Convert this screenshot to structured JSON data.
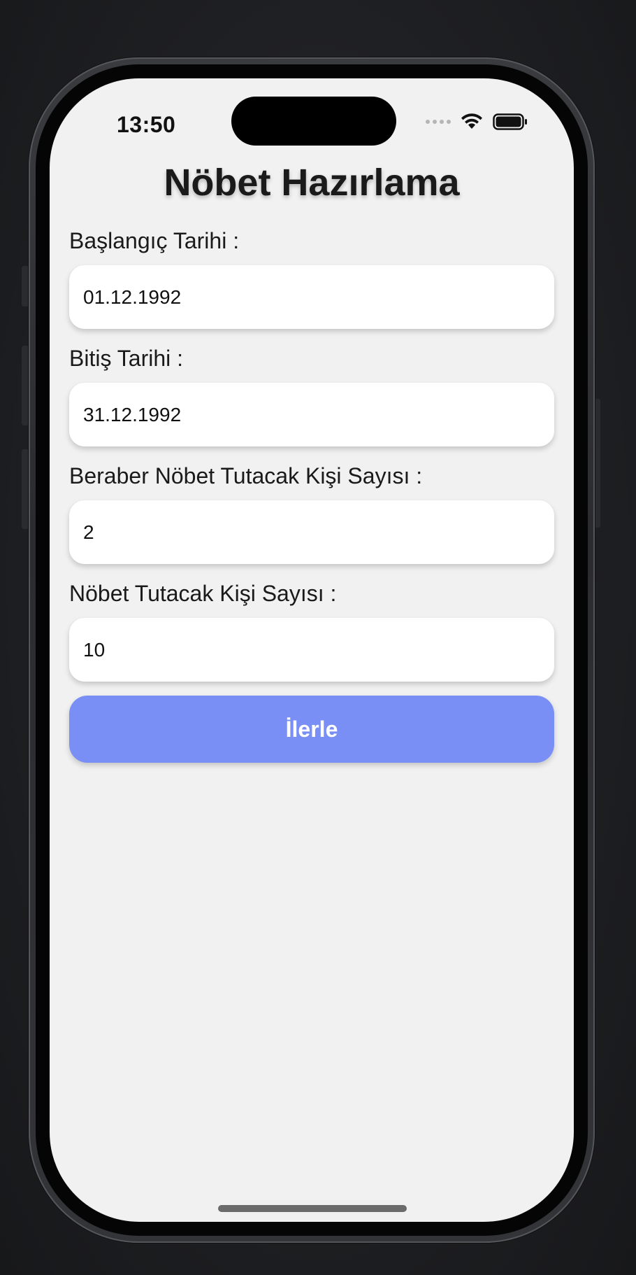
{
  "status_bar": {
    "time": "13:50"
  },
  "page": {
    "title": "Nöbet Hazırlama"
  },
  "form": {
    "fields": [
      {
        "label": "Başlangıç Tarihi :",
        "value": "01.12.1992"
      },
      {
        "label": "Bitiş Tarihi :",
        "value": "31.12.1992"
      },
      {
        "label": "Beraber Nöbet Tutacak Kişi Sayısı :",
        "value": "2"
      },
      {
        "label": "Nöbet Tutacak Kişi Sayısı :",
        "value": "10"
      }
    ],
    "submit_label": "İlerle"
  },
  "icons": [
    "signal-icon",
    "wifi-icon",
    "battery-icon"
  ],
  "colors": {
    "screen_background": "#f1f1f1",
    "input_background": "#ffffff",
    "button_accent": "#7a8ff5",
    "button_text": "#ffffff",
    "text": "#1a1a1a"
  }
}
